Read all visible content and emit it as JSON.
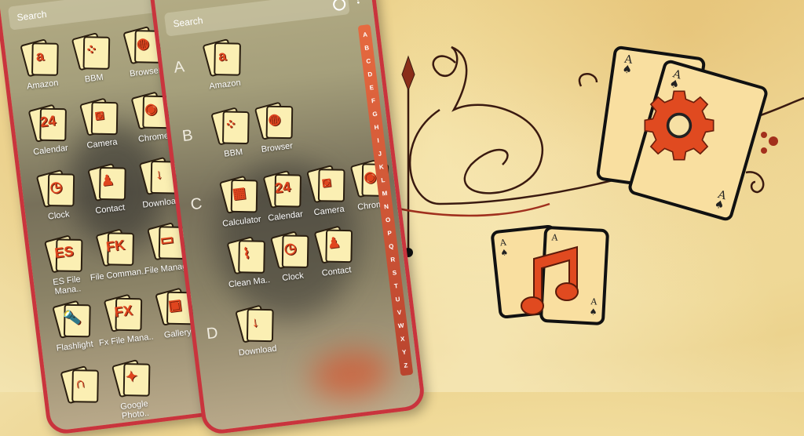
{
  "back_phone": {
    "search_placeholder": "Search",
    "apps": [
      {
        "label": "Amazon",
        "icon": "amazon-icon",
        "glyph": "a"
      },
      {
        "label": "BBM",
        "icon": "bbm-icon",
        "glyph": "⁘"
      },
      {
        "label": "Browser",
        "icon": "globe-icon",
        "glyph": "◍"
      },
      {
        "label": "Calendar",
        "icon": "calendar-icon",
        "glyph": "24"
      },
      {
        "label": "Camera",
        "icon": "camera-icon",
        "glyph": "◙"
      },
      {
        "label": "Chrome",
        "icon": "chrome-icon",
        "glyph": "◉"
      },
      {
        "label": "Clock",
        "icon": "clock-icon",
        "glyph": "◷"
      },
      {
        "label": "Contact",
        "icon": "contact-icon",
        "glyph": "♟"
      },
      {
        "label": "Download",
        "icon": "download-icon",
        "glyph": "↓"
      },
      {
        "label": "ES File Mana..",
        "icon": "es-file-manager-icon",
        "glyph": "ES"
      },
      {
        "label": "File Comman..",
        "icon": "file-commander-icon",
        "glyph": "FK"
      },
      {
        "label": "File Manager",
        "icon": "folder-icon",
        "glyph": "▭"
      },
      {
        "label": "Flashlight",
        "icon": "flashlight-icon",
        "glyph": "🔦"
      },
      {
        "label": "Fx File Mana..",
        "icon": "fx-file-manager-icon",
        "glyph": "FX"
      },
      {
        "label": "Gallery",
        "icon": "gallery-icon",
        "glyph": "▣"
      },
      {
        "label": "",
        "icon": "headphones-icon",
        "glyph": "∩"
      },
      {
        "label": "Google Photo..",
        "icon": "google-photos-icon",
        "glyph": "✦"
      }
    ]
  },
  "front_phone": {
    "search_placeholder": "Search",
    "sections": [
      {
        "letter": "A",
        "apps": [
          {
            "label": "Amazon",
            "icon": "amazon-icon",
            "glyph": "a"
          }
        ]
      },
      {
        "letter": "B",
        "apps": [
          {
            "label": "BBM",
            "icon": "bbm-icon",
            "glyph": "⁘"
          },
          {
            "label": "Browser",
            "icon": "globe-icon",
            "glyph": "◍"
          }
        ]
      },
      {
        "letter": "C",
        "apps": [
          {
            "label": "Calculator",
            "icon": "calculator-icon",
            "glyph": "▦"
          },
          {
            "label": "Calendar",
            "icon": "calendar-icon",
            "glyph": "24"
          },
          {
            "label": "Camera",
            "icon": "camera-icon",
            "glyph": "◙"
          },
          {
            "label": "Chrome",
            "icon": "chrome-icon",
            "glyph": "◉"
          },
          {
            "label": "Clean Ma..",
            "icon": "broom-icon",
            "glyph": "⌇"
          },
          {
            "label": "Clock",
            "icon": "clock-icon",
            "glyph": "◷"
          },
          {
            "label": "Contact",
            "icon": "contact-icon",
            "glyph": "♟"
          }
        ]
      },
      {
        "letter": "D",
        "apps": [
          {
            "label": "Download",
            "icon": "download-icon",
            "glyph": "↓"
          }
        ]
      }
    ],
    "az_index": [
      "A",
      "B",
      "C",
      "D",
      "E",
      "F",
      "G",
      "H",
      "I",
      "J",
      "K",
      "L",
      "M",
      "N",
      "O",
      "P",
      "Q",
      "R",
      "S",
      "T",
      "U",
      "V",
      "W",
      "X",
      "Y",
      "Z"
    ]
  },
  "promo": {
    "card_ace_label": "A",
    "card_suit": "♠",
    "gear_icon": "settings-gear-icon",
    "music_icon": "music-note-icon"
  },
  "colors": {
    "phone_frame": "#c9343d",
    "accent_orange": "#e0451e",
    "card_bg": "#f9dfa0",
    "az_index_bg": "#e66a40"
  }
}
